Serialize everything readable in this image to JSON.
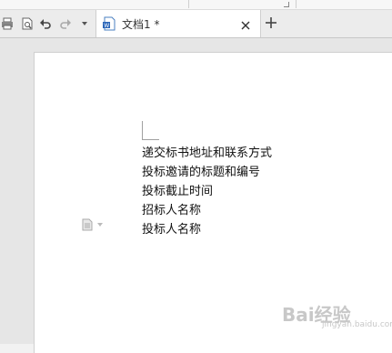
{
  "tab": {
    "title": "文档1 *"
  },
  "document": {
    "lines": [
      "递交标书地址和联系方式",
      "投标邀请的标题和编号",
      "投标截止时间",
      "招标人名称",
      "投标人名称"
    ]
  },
  "watermark": {
    "main": "Bai经验",
    "sub": "jingyan.baidu.com"
  },
  "icons": {
    "print": "print-icon",
    "print_preview": "print-preview-icon",
    "undo": "undo-icon",
    "redo": "redo-icon",
    "more": "chevron-down-icon",
    "doc": "writer-doc-icon",
    "close": "close-icon",
    "new_tab": "plus-icon",
    "paragraph": "paragraph-options-icon"
  }
}
